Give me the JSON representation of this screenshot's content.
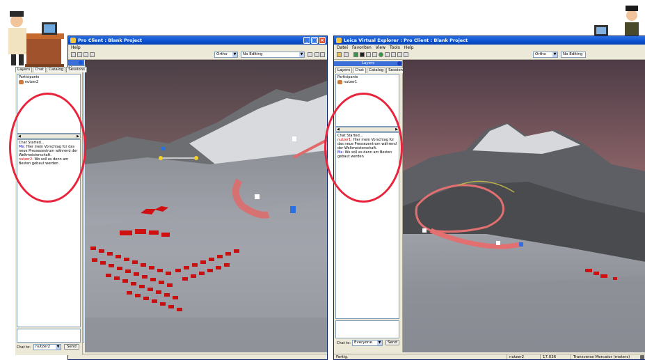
{
  "left_window": {
    "title": "Pro Client : Blank Project",
    "menu": [
      "Help"
    ],
    "view_mode": "Ortho",
    "edit_mode": "No Editing",
    "side_panel_header": "",
    "tabs": [
      "Layers",
      "Chat",
      "Catalog",
      "Sessions"
    ],
    "active_tab": "Chat",
    "participants_label": "Participants",
    "participants": [
      "nutzer2"
    ],
    "chat_started": "Chat Started...",
    "chat": [
      {
        "from": "Me:",
        "text": "Hier mein Vorschlag für das",
        "cont": [
          "neue Pressezentrum während der",
          "Weltmeisterschaft."
        ]
      },
      {
        "from": "nutzer2:",
        "text": "Wo soll es denn am",
        "cont": [
          "Besten gebaut werden"
        ]
      }
    ],
    "chat_to_label": "Chat to:",
    "chat_to_value": "nutzer2",
    "send_label": "Send"
  },
  "right_window": {
    "title": "Leica Virtual Explorer : Pro Client : Blank Project",
    "menu": [
      "Datei",
      "Favoriten",
      "View",
      "Tools",
      "Help"
    ],
    "view_mode": "Ortho",
    "edit_mode": "No Editing",
    "side_panel_header": "Layers",
    "tabs": [
      "Layers",
      "Chat",
      "Catalog",
      "Sessions"
    ],
    "active_tab": "Chat",
    "participants_label": "Participants",
    "participants": [
      "nutzer1"
    ],
    "chat_started": "Chat Started...",
    "chat": [
      {
        "from": "nutzer1:",
        "text": "Hier mein Vorschlag für",
        "cont": [
          "das neue Pressezentrum während",
          "der Weltmeisterschaft."
        ]
      },
      {
        "from": "Me:",
        "text": "Wo soll es denn am Besten",
        "cont": [
          "gebaut werden"
        ]
      }
    ],
    "chat_to_label": "Chat to:",
    "chat_to_value": "Everyone",
    "send_label": "Send",
    "status": {
      "left": "Fertig.",
      "user": "nutzer2",
      "value": "17.036",
      "projection": "Transverse Mercator (meters)"
    }
  },
  "colors": {
    "highlight_circle": "#e8243c",
    "title_blue": "#0a50d0",
    "building_red": "#d01010"
  }
}
